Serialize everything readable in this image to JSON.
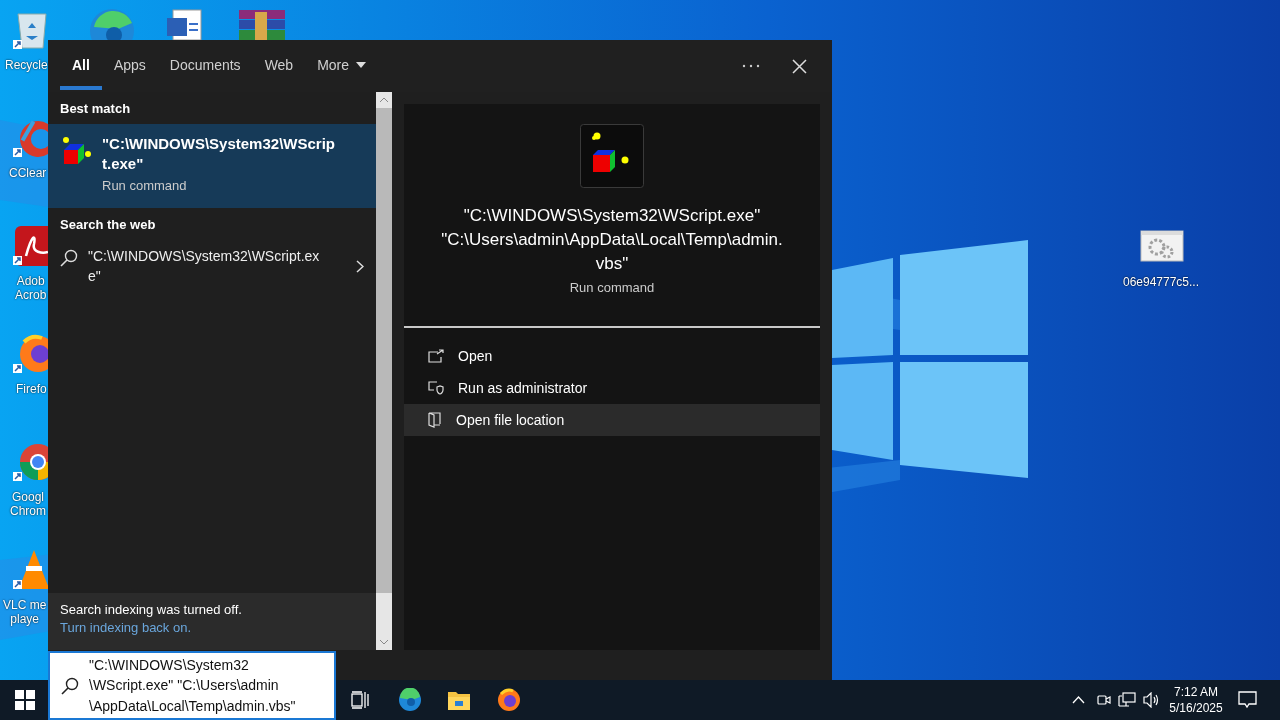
{
  "desktop": {
    "icons": [
      {
        "lines": [
          "Recycle"
        ]
      },
      {
        "lines": [
          "CClear"
        ]
      },
      {
        "lines": [
          "Adob",
          "Acrob"
        ]
      },
      {
        "lines": [
          "Firefo"
        ]
      },
      {
        "lines": [
          "Googl",
          "Chrom"
        ]
      },
      {
        "lines": [
          "VLC me",
          "playe"
        ]
      },
      {
        "lines": [
          "06e94777c5..."
        ]
      }
    ]
  },
  "search": {
    "tabs": [
      {
        "label": "All",
        "selected": true
      },
      {
        "label": "Apps",
        "selected": false
      },
      {
        "label": "Documents",
        "selected": false
      },
      {
        "label": "Web",
        "selected": false
      }
    ],
    "more": {
      "label": "More"
    },
    "best_match": {
      "header": "Best match",
      "result": {
        "title_lines": [
          "\"C:\\WINDOWS\\System32\\WScrip",
          "t.exe\""
        ],
        "subtitle": "Run command",
        "selected": true
      }
    },
    "web": {
      "header": "Search the web",
      "result": {
        "lines": [
          "\"C:\\WINDOWS\\System32\\WScript.ex",
          "e\""
        ]
      }
    },
    "notice": {
      "message": "Search indexing was turned off.",
      "link": "Turn indexing back on."
    },
    "preview": {
      "title_lines": [
        "\"C:\\WINDOWS\\System32\\WScript.exe\"",
        "\"C:\\Users\\admin\\AppData\\Local\\Temp\\admin.",
        "vbs\""
      ],
      "subtitle": "Run command"
    },
    "actions": [
      {
        "label": "Open",
        "kind": "open",
        "selected": false
      },
      {
        "label": "Run as administrator",
        "kind": "admin",
        "selected": false
      },
      {
        "label": "Open file location",
        "kind": "location",
        "selected": true
      }
    ]
  },
  "search_box": {
    "value_lines": [
      "\"C:\\WINDOWS\\System32",
      "\\WScript.exe\" \"C:\\Users\\admin",
      "\\AppData\\Local\\Temp\\admin.vbs\""
    ]
  },
  "taskbar": {
    "time": "7:12 AM",
    "date": "5/16/2025"
  }
}
